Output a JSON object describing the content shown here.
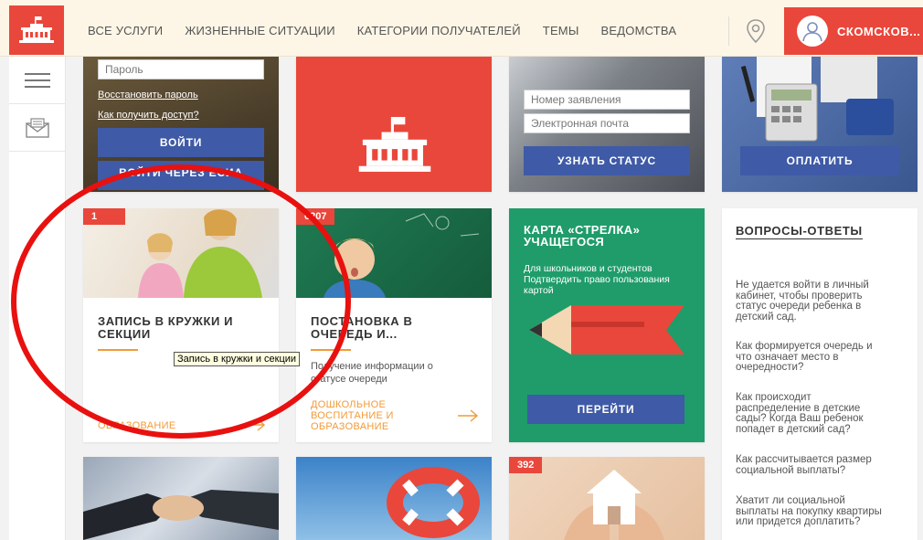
{
  "header": {
    "nav": [
      "ВСЕ УСЛУГИ",
      "ЖИЗНЕННЫЕ СИТУАЦИИ",
      "КАТЕГОРИИ ПОЛУЧАТЕЛЕЙ",
      "ТЕМЫ",
      "ВЕДОМСТВА"
    ],
    "user_name": "СКОМСКОВ..."
  },
  "login": {
    "password_placeholder": "Пароль",
    "restore_link": "Восстановить пароль",
    "access_link": "Как получить доступ?",
    "login_button": "ВОЙТИ",
    "second_button": "ВОЙТИ ЧЕРЕЗ ЕСИА"
  },
  "status": {
    "application_placeholder": "Номер заявления",
    "email_placeholder": "Электронная почта",
    "button": "УЗНАТЬ СТАТУС"
  },
  "pay": {
    "button": "ОПЛАТИТЬ"
  },
  "cards": [
    {
      "badge": "1",
      "title_line1": "ЗАПИСЬ В КРУЖКИ И",
      "title_line2": "СЕКЦИИ",
      "category": "ОБРАЗОВАНИЕ"
    },
    {
      "badge": "6207",
      "title_line1": "ПОСТАНОВКА В",
      "title_line2": "ОЧЕРЕДЬ И...",
      "desc_line1": "Получение информации о",
      "desc_line2": "статусе очереди",
      "cat_line1": "ДОШКОЛЬНОЕ",
      "cat_line2": "ВОСПИТАНИЕ И",
      "cat_line3": "ОБРАЗОВАНИЕ"
    }
  ],
  "strelka": {
    "title_line1": "КАРТА «СТРЕЛКА»",
    "title_line2": "УЧАЩЕГОСЯ",
    "desc_line1": "Для школьников и студентов",
    "desc_line2": "Подтвердить право пользования",
    "desc_line3": "картой",
    "button": "ПЕРЕЙТИ"
  },
  "faq": {
    "title": "ВОПРОСЫ-ОТВЕТЫ",
    "items": [
      [
        "Не удается войти в личный",
        "кабинет, чтобы проверить",
        "статус очереди ребенка в",
        "детский сад."
      ],
      [
        "Как формируется очередь и",
        "что означает место в",
        "очередности?"
      ],
      [
        "Как происходит",
        "распределение в детские",
        "сады? Когда Ваш ребенок",
        "попадет в детский сад?"
      ],
      [
        "Как рассчитывается размер",
        "социальной выплаты?"
      ],
      [
        "Хватит ли социальной",
        "выплаты на покупку квартиры",
        "или придется доплатить?"
      ]
    ]
  },
  "bottom": {
    "badge": "392"
  },
  "tooltip": "Запись в кружки и секции",
  "colors": {
    "accent_red": "#e9473b",
    "button_blue": "#3f5aa6",
    "orange": "#f29b38",
    "green": "#1f9c6a",
    "annotation_red": "#e8110f"
  }
}
